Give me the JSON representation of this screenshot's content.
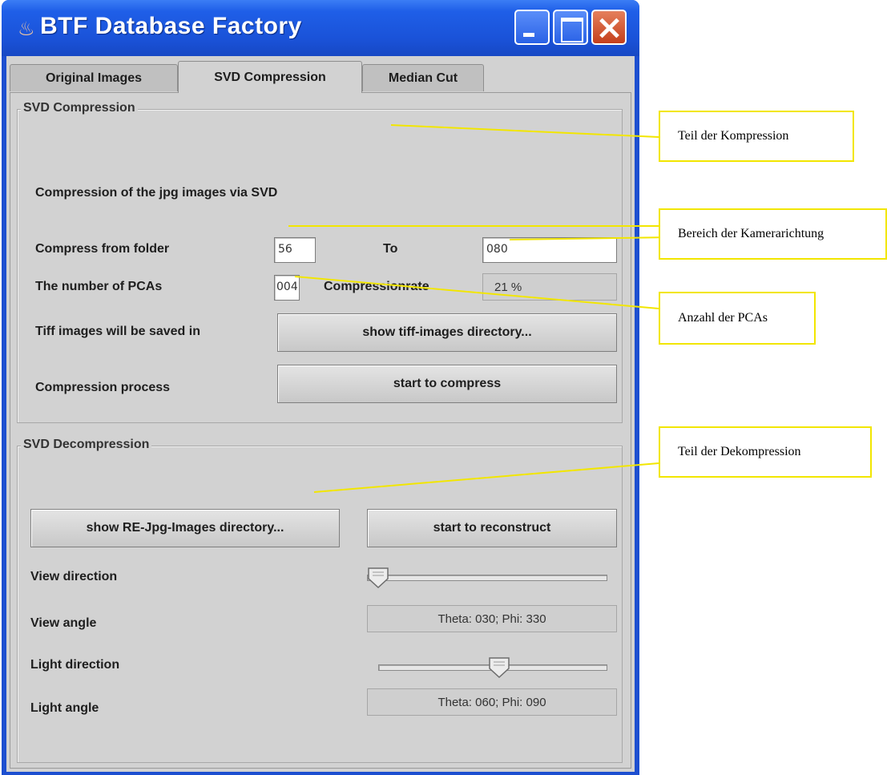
{
  "window": {
    "title": "BTF Database Factory"
  },
  "tabs": [
    {
      "label": "Original Images",
      "active": false
    },
    {
      "label": "SVD Compression",
      "active": true
    },
    {
      "label": "Median Cut",
      "active": false
    }
  ],
  "compression": {
    "group_title": "SVD Compression",
    "description": "Compression of the jpg images via SVD",
    "folder_label": "Compress from folder",
    "from_value": "56",
    "to_label": "To",
    "to_value": "080",
    "pcas_label": "The number of PCAs",
    "pcas_value": "004",
    "rate_label": "Compressionrate",
    "rate_value": "21 %",
    "tiff_label": "Tiff images will be saved in",
    "tiff_button": "show tiff-images directory...",
    "process_label": "Compression process",
    "start_button": "start to compress"
  },
  "decompression": {
    "group_title": "SVD Decompression",
    "show_button": "show RE-Jpg-Images directory...",
    "reconstruct_button": "start to reconstruct",
    "view_direction_label": "View direction",
    "view_direction_level": 0,
    "view_angle_label": "View angle",
    "view_angle_value": "Theta: 030; Phi: 330",
    "light_direction_label": "Light direction",
    "light_direction_level": 0.53,
    "light_angle_label": "Light angle",
    "light_angle_value": "Theta: 060; Phi: 090"
  },
  "annotations": {
    "compression_part": "Teil der Kompression",
    "camera_range": "Bereich der Kamerarichtung",
    "pca_count": "Anzahl der PCAs",
    "decompression_part": "Teil der Dekompression"
  },
  "colors": {
    "titlebar": "#1f5fe8",
    "annotation_border": "#f2e600",
    "close_button": "#c43f1c"
  }
}
